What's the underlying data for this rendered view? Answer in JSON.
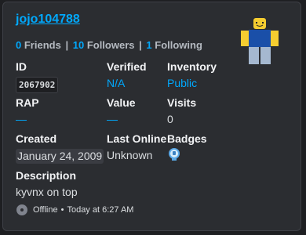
{
  "profile": {
    "username": "jojo104788",
    "friends_count": "0",
    "friends_label": "Friends",
    "followers_count": "10",
    "followers_label": "Followers",
    "following_count": "1",
    "following_label": "Following",
    "separator": "|"
  },
  "fields": {
    "id": {
      "label": "ID",
      "value": "2067902"
    },
    "verified": {
      "label": "Verified",
      "value": "N/A"
    },
    "inventory": {
      "label": "Inventory",
      "value": "Public"
    },
    "rap": {
      "label": "RAP",
      "value": "—"
    },
    "value": {
      "label": "Value",
      "value": "—"
    },
    "visits": {
      "label": "Visits",
      "value": "0"
    },
    "created": {
      "label": "Created",
      "value": "January 24, 2009"
    },
    "last_online": {
      "label": "Last Online",
      "value": "Unknown"
    },
    "badges": {
      "label": "Badges",
      "icon": "badge-icon"
    }
  },
  "description": {
    "label": "Description",
    "text": "kyvnx on top"
  },
  "footer": {
    "status": "Offline",
    "separator": "•",
    "timestamp": "Today at 6:27 AM"
  },
  "colors": {
    "link": "#00a8fc",
    "background": "#2b2d31",
    "offline": "#80848e"
  }
}
